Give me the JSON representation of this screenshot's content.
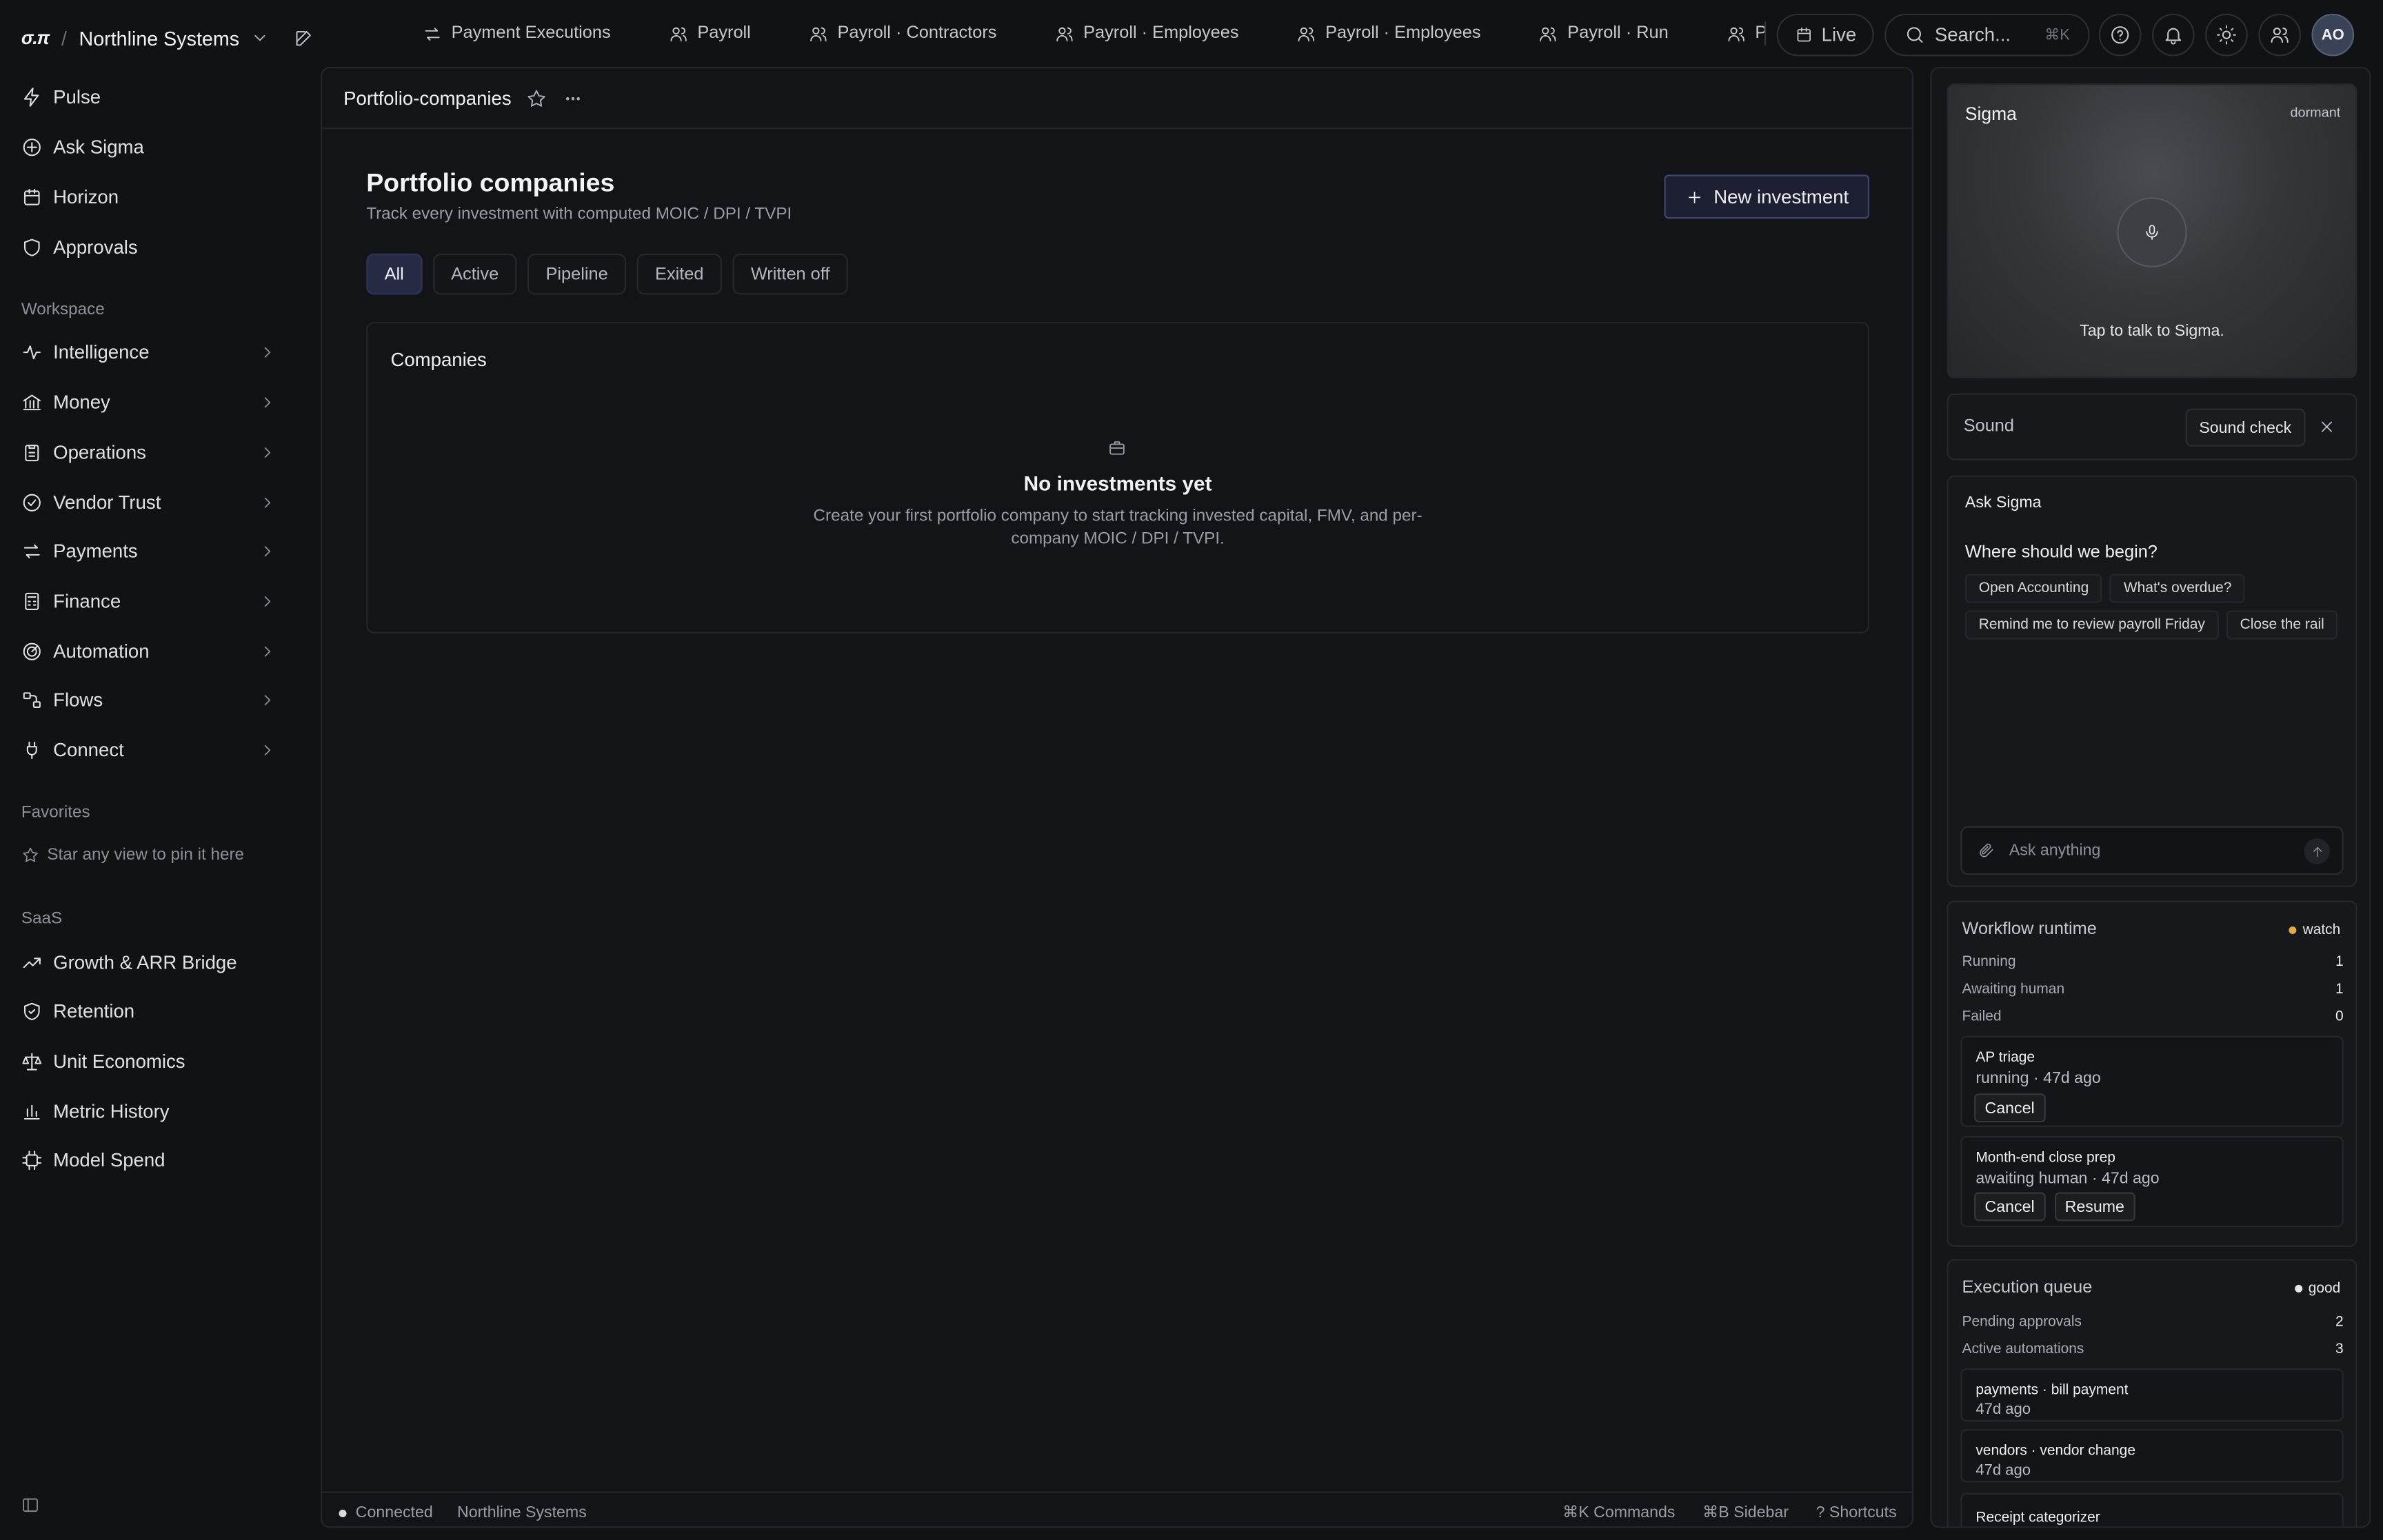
{
  "brand": {
    "logo": "σ.π",
    "org": "Northline Systems"
  },
  "sidebar": {
    "primary": [
      {
        "label": "Pulse",
        "icon": "bolt-icon"
      },
      {
        "label": "Ask Sigma",
        "icon": "sparkle-icon"
      },
      {
        "label": "Horizon",
        "icon": "calendar-icon"
      },
      {
        "label": "Approvals",
        "icon": "shield-icon"
      }
    ],
    "workspace_label": "Workspace",
    "workspace": [
      {
        "label": "Intelligence",
        "icon": "pulse-icon"
      },
      {
        "label": "Money",
        "icon": "bank-icon"
      },
      {
        "label": "Operations",
        "icon": "clipboard-icon"
      },
      {
        "label": "Vendor Trust",
        "icon": "check-circle-icon"
      },
      {
        "label": "Payments",
        "icon": "transfer-icon"
      },
      {
        "label": "Finance",
        "icon": "calculator-icon"
      },
      {
        "label": "Automation",
        "icon": "radar-icon"
      },
      {
        "label": "Flows",
        "icon": "flow-icon"
      },
      {
        "label": "Connect",
        "icon": "plug-icon"
      }
    ],
    "favorites_label": "Favorites",
    "favorites_hint": "Star any view to pin it here",
    "saas_label": "SaaS",
    "saas": [
      {
        "label": "Growth & ARR Bridge",
        "icon": "trend-icon"
      },
      {
        "label": "Retention",
        "icon": "shield-icon"
      },
      {
        "label": "Unit Economics",
        "icon": "scale-icon"
      },
      {
        "label": "Metric History",
        "icon": "bar-chart-icon"
      },
      {
        "label": "Model Spend",
        "icon": "chip-icon"
      }
    ]
  },
  "topbar": {
    "tabs": [
      {
        "label": "Payment Executions",
        "icon": "transfer-icon"
      },
      {
        "label": "Payroll",
        "icon": "users-icon"
      },
      {
        "label": "Payroll · Contractors",
        "icon": "users-icon"
      },
      {
        "label": "Payroll · Employees",
        "icon": "users-icon"
      },
      {
        "label": "Payroll · Employees",
        "icon": "users-icon"
      },
      {
        "label": "Payroll · Run",
        "icon": "users-icon"
      },
      {
        "label": "Payroll",
        "icon": "users-icon"
      }
    ],
    "live_label": "Live",
    "search_placeholder": "Search...",
    "search_shortcut": "⌘K",
    "avatar_initials": "AO"
  },
  "main": {
    "breadcrumb": "Portfolio-companies",
    "title": "Portfolio companies",
    "subtitle": "Track every investment with computed MOIC / DPI / TVPI",
    "new_button": "New investment",
    "filters": [
      "All",
      "Active",
      "Pipeline",
      "Exited",
      "Written off"
    ],
    "active_filter": "All",
    "companies_title": "Companies",
    "empty_title": "No investments yet",
    "empty_desc": "Create your first portfolio company to start tracking invested capital, FMV, and per-company MOIC / DPI / TVPI.",
    "footer": {
      "status": "Connected",
      "org": "Northline Systems",
      "commands": "⌘K Commands",
      "sidebar": "⌘B Sidebar",
      "shortcuts": "? Shortcuts"
    }
  },
  "right": {
    "voice": {
      "name": "Sigma",
      "state": "dormant",
      "hint": "Tap to talk to Sigma."
    },
    "sound": {
      "label": "Sound",
      "button": "Sound check"
    },
    "ask": {
      "title": "Ask Sigma",
      "question": "Where should we begin?",
      "suggestions": [
        "Open Accounting",
        "What's overdue?",
        "Remind me to review payroll Friday",
        "Close the rail"
      ],
      "placeholder": "Ask anything"
    },
    "workflow": {
      "title": "Workflow runtime",
      "badge": "watch",
      "badge_color": "#e0a94a",
      "stats": [
        {
          "label": "Running",
          "value": "1"
        },
        {
          "label": "Awaiting human",
          "value": "1"
        },
        {
          "label": "Failed",
          "value": "0"
        }
      ],
      "items": [
        {
          "name": "AP triage",
          "status": "running · 47d ago",
          "cancel": "Cancel"
        },
        {
          "name": "Month-end close prep",
          "status": "awaiting human · 47d ago",
          "cancel": "Cancel",
          "resume": "Resume"
        }
      ]
    },
    "queue": {
      "title": "Execution queue",
      "badge": "good",
      "badge_color": "#e6e7ea",
      "stats": [
        {
          "label": "Pending approvals",
          "value": "2"
        },
        {
          "label": "Active automations",
          "value": "3"
        }
      ],
      "items": [
        {
          "name": "payments · bill payment",
          "time": "47d ago"
        },
        {
          "name": "vendors · vendor change",
          "time": "47d ago"
        },
        {
          "name": "Receipt categorizer"
        }
      ]
    }
  }
}
